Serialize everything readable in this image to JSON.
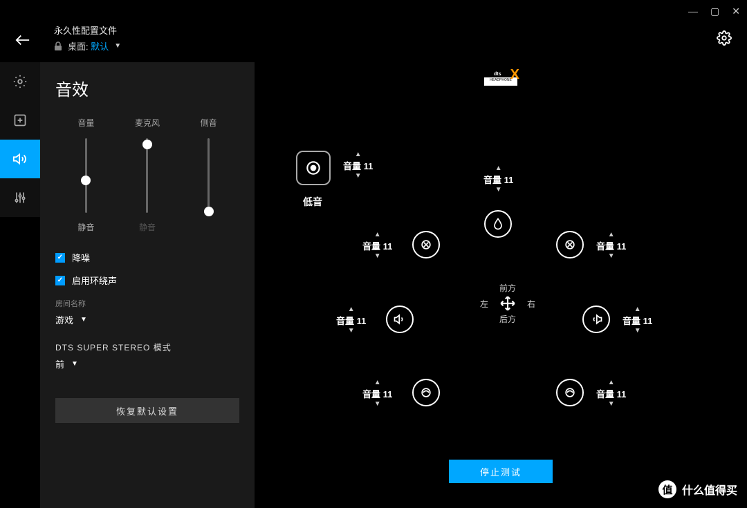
{
  "window": {
    "min": "—",
    "max": "▢",
    "close": "✕"
  },
  "header": {
    "profile_title": "永久性配置文件",
    "profile_prefix": "桌面:",
    "profile_name": "默认"
  },
  "sidebar": {
    "panel_title": "音效",
    "sliders": {
      "volume": {
        "label": "音量",
        "bottom": "静音",
        "thumb_pct": 50
      },
      "mic": {
        "label": "麦克风",
        "bottom": "静音",
        "thumb_pct": 5
      },
      "sidetone": {
        "label": "侧音",
        "bottom": "",
        "thumb_pct": 95
      }
    },
    "noise_reduction": {
      "checked": true,
      "label": "降噪"
    },
    "surround": {
      "checked": true,
      "label": "启用环绕声"
    },
    "room": {
      "label": "房间名称",
      "value": "游戏"
    },
    "dts": {
      "label": "DTS SUPER STEREO 模式",
      "value": "前"
    },
    "reset_label": "恢复默认设置"
  },
  "main": {
    "bass_label": "低音",
    "vol_prefix": "音量",
    "channels": {
      "bass": {
        "value": 11
      },
      "center": {
        "value": 11
      },
      "fl": {
        "value": 11
      },
      "fr": {
        "value": 11
      },
      "sl": {
        "value": 11
      },
      "sr": {
        "value": 11
      },
      "rl": {
        "value": 11
      },
      "rr": {
        "value": 11
      }
    },
    "compass": {
      "front": "前方",
      "left": "左",
      "right": "右",
      "rear": "后方"
    },
    "stop_test": "停止测试"
  },
  "watermark": "什么值得买"
}
